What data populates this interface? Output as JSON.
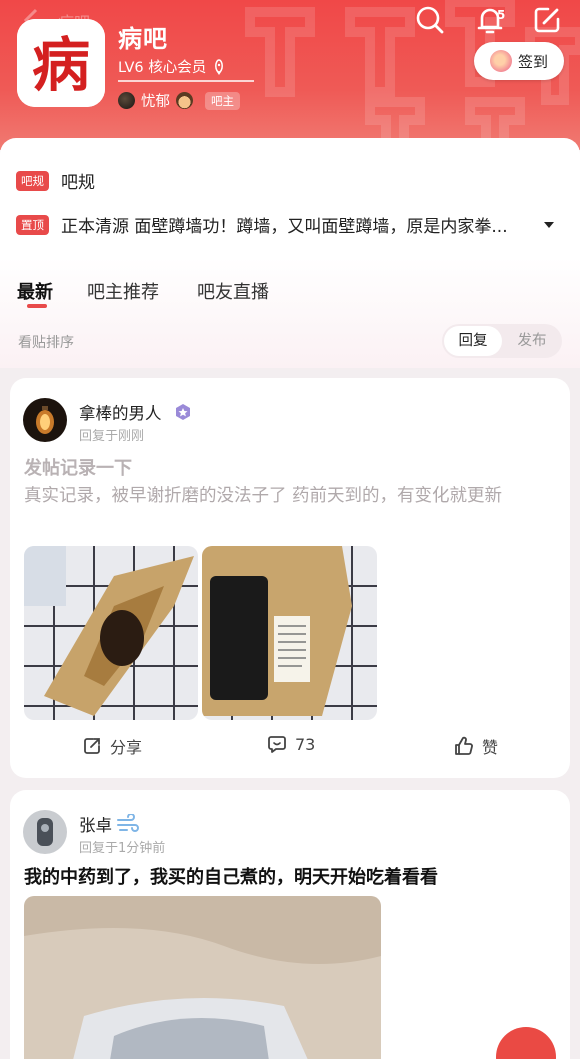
{
  "header": {
    "back_label": "病吧",
    "notification_count": "5",
    "forum_name": "病吧",
    "logo_glyph": "病",
    "member_level": "LV6 核心会员",
    "owner_name": "忧郁",
    "owner_tag": "吧主",
    "signin_label": "签到"
  },
  "info": {
    "rule_badge": "吧规",
    "rule_text": "吧规",
    "top_badge": "置顶",
    "top_text": "正本清源 面壁蹲墙功！蹲墙，又叫面壁蹲墙，原是内家拳..."
  },
  "tabs": [
    {
      "label": "最新"
    },
    {
      "label": "吧主推荐"
    },
    {
      "label": "吧友直播"
    }
  ],
  "sort": {
    "label": "看贴排序",
    "reply": "回复",
    "post": "发布"
  },
  "posts": [
    {
      "author": "拿棒的男人",
      "time": "回复于刚刚",
      "title": "发帖记录一下",
      "body": "真实记录，被早谢折磨的没法子了 药前天到的，有变化就更新",
      "share_label": "分享",
      "comment_count": "73",
      "like_label": "赞"
    },
    {
      "author": "张卓",
      "time": "回复于1分钟前",
      "title": "我的中药到了，我买的自己煮的，明天开始吃着看看"
    }
  ],
  "colors": {
    "brand_red": "#ef4848",
    "badge_red": "#e84a4a"
  }
}
